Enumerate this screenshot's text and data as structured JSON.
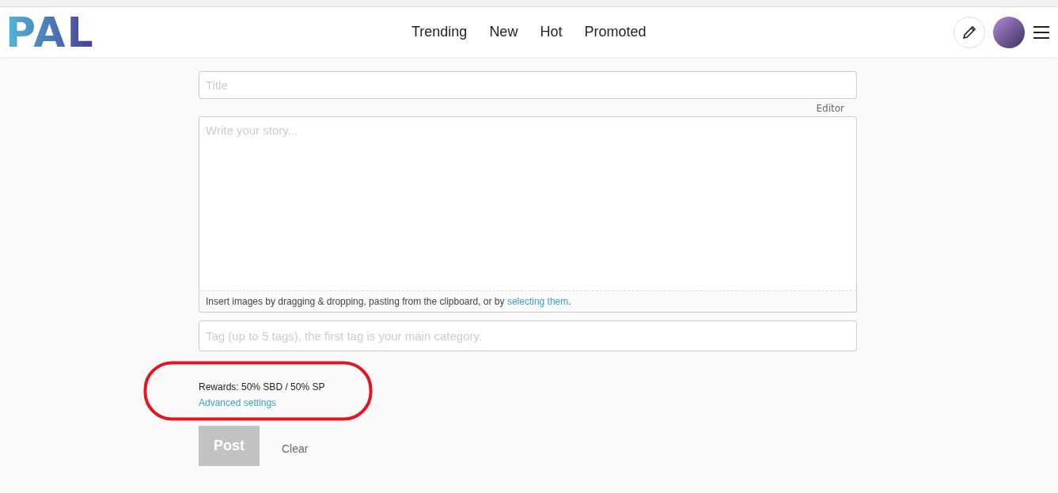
{
  "header": {
    "logo": "PAL",
    "nav": [
      {
        "label": "Trending"
      },
      {
        "label": "New"
      },
      {
        "label": "Hot"
      },
      {
        "label": "Promoted"
      }
    ]
  },
  "editor": {
    "title": {
      "placeholder": "Title"
    },
    "mode_link": "Editor",
    "body": {
      "placeholder": "Write your story..."
    },
    "upload_hint": {
      "text": "Insert images by dragging & dropping, pasting from the clipboard, or by ",
      "link": "selecting them",
      "end": "."
    },
    "tags": {
      "placeholder": "Tag (up to 5 tags), the first tag is your main category."
    },
    "rewards": "Rewards: 50% SBD / 50% SP",
    "advanced_link": "Advanced settings",
    "highlighted": true,
    "post_button": {
      "label": "Post",
      "disabled": true
    },
    "clear_button": "Clear"
  }
}
